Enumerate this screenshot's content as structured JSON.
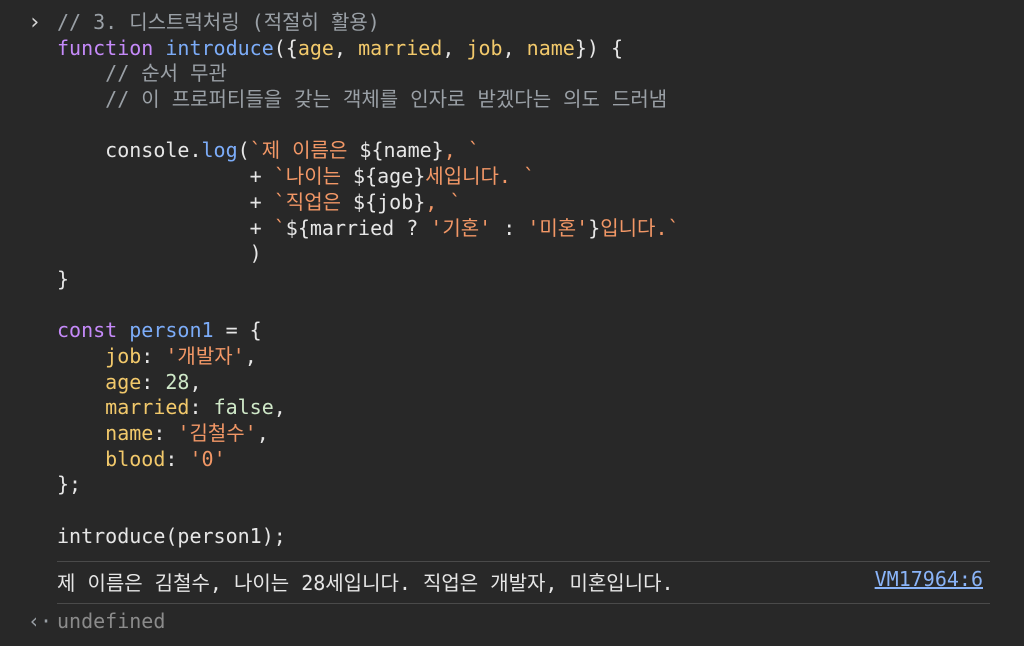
{
  "colors": {
    "background": "#282828",
    "keyword": "#c58af9",
    "function_name": "#7cacf8",
    "property": "#f2c96b",
    "string": "#f29766",
    "number": "#cfe8c8",
    "comment": "#9aa0a6",
    "link": "#8ab4f8"
  },
  "icons": {
    "prompt": "chevron-right-icon",
    "return": "return-arrow-icon"
  },
  "prompt_symbol": "›",
  "code_lines": [
    [
      {
        "t": "// 3. 디스트럭처링 (적절히 활용)",
        "c": "cmt"
      }
    ],
    [
      {
        "t": "function",
        "c": "kw"
      },
      {
        "t": " ",
        "c": "txt"
      },
      {
        "t": "introduce",
        "c": "fn"
      },
      {
        "t": "({",
        "c": "txt"
      },
      {
        "t": "age",
        "c": "prop"
      },
      {
        "t": ", ",
        "c": "txt"
      },
      {
        "t": "married",
        "c": "prop"
      },
      {
        "t": ", ",
        "c": "txt"
      },
      {
        "t": "job",
        "c": "prop"
      },
      {
        "t": ", ",
        "c": "txt"
      },
      {
        "t": "name",
        "c": "prop"
      },
      {
        "t": "}) {",
        "c": "txt"
      }
    ],
    [
      {
        "t": "    // 순서 무관",
        "c": "cmt"
      }
    ],
    [
      {
        "t": "    // 이 프로퍼티들을 갖는 객체를 인자로 받겠다는 의도 드러냄",
        "c": "cmt"
      }
    ],
    [
      {
        "t": "",
        "c": "txt"
      }
    ],
    [
      {
        "t": "    console.",
        "c": "txt"
      },
      {
        "t": "log",
        "c": "fn"
      },
      {
        "t": "(",
        "c": "txt"
      },
      {
        "t": "`제 이름은 ",
        "c": "str"
      },
      {
        "t": "${name}",
        "c": "txt"
      },
      {
        "t": ", `",
        "c": "str"
      }
    ],
    [
      {
        "t": "                + ",
        "c": "txt"
      },
      {
        "t": "`나이는 ",
        "c": "str"
      },
      {
        "t": "${age}",
        "c": "txt"
      },
      {
        "t": "세입니다. `",
        "c": "str"
      }
    ],
    [
      {
        "t": "                + ",
        "c": "txt"
      },
      {
        "t": "`직업은 ",
        "c": "str"
      },
      {
        "t": "${job}",
        "c": "txt"
      },
      {
        "t": ", `",
        "c": "str"
      }
    ],
    [
      {
        "t": "                + ",
        "c": "txt"
      },
      {
        "t": "`",
        "c": "str"
      },
      {
        "t": "${married ? ",
        "c": "txt"
      },
      {
        "t": "'기혼'",
        "c": "str"
      },
      {
        "t": " : ",
        "c": "txt"
      },
      {
        "t": "'미혼'",
        "c": "str"
      },
      {
        "t": "}",
        "c": "txt"
      },
      {
        "t": "입니다.`",
        "c": "str"
      }
    ],
    [
      {
        "t": "                )",
        "c": "txt"
      }
    ],
    [
      {
        "t": "}",
        "c": "txt"
      }
    ],
    [
      {
        "t": "",
        "c": "txt"
      }
    ],
    [
      {
        "t": "const",
        "c": "kw"
      },
      {
        "t": " ",
        "c": "txt"
      },
      {
        "t": "person1",
        "c": "fn"
      },
      {
        "t": " = {",
        "c": "txt"
      }
    ],
    [
      {
        "t": "    ",
        "c": "txt"
      },
      {
        "t": "job",
        "c": "prop"
      },
      {
        "t": ": ",
        "c": "txt"
      },
      {
        "t": "'개발자'",
        "c": "str"
      },
      {
        "t": ",",
        "c": "txt"
      }
    ],
    [
      {
        "t": "    ",
        "c": "txt"
      },
      {
        "t": "age",
        "c": "prop"
      },
      {
        "t": ": ",
        "c": "txt"
      },
      {
        "t": "28",
        "c": "num"
      },
      {
        "t": ",",
        "c": "txt"
      }
    ],
    [
      {
        "t": "    ",
        "c": "txt"
      },
      {
        "t": "married",
        "c": "prop"
      },
      {
        "t": ": ",
        "c": "txt"
      },
      {
        "t": "false",
        "c": "num"
      },
      {
        "t": ",",
        "c": "txt"
      }
    ],
    [
      {
        "t": "    ",
        "c": "txt"
      },
      {
        "t": "name",
        "c": "prop"
      },
      {
        "t": ": ",
        "c": "txt"
      },
      {
        "t": "'김철수'",
        "c": "str"
      },
      {
        "t": ",",
        "c": "txt"
      }
    ],
    [
      {
        "t": "    ",
        "c": "txt"
      },
      {
        "t": "blood",
        "c": "prop"
      },
      {
        "t": ": ",
        "c": "txt"
      },
      {
        "t": "'0'",
        "c": "str"
      }
    ],
    [
      {
        "t": "};",
        "c": "txt"
      }
    ],
    [
      {
        "t": "",
        "c": "txt"
      }
    ],
    [
      {
        "t": "introduce(person1);",
        "c": "txt"
      }
    ]
  ],
  "log": {
    "message": "제 이름은 김철수, 나이는 28세입니다. 직업은 개발자, 미혼입니다.",
    "source": "VM17964:6"
  },
  "return_symbol": "‹·",
  "return_value": "undefined"
}
